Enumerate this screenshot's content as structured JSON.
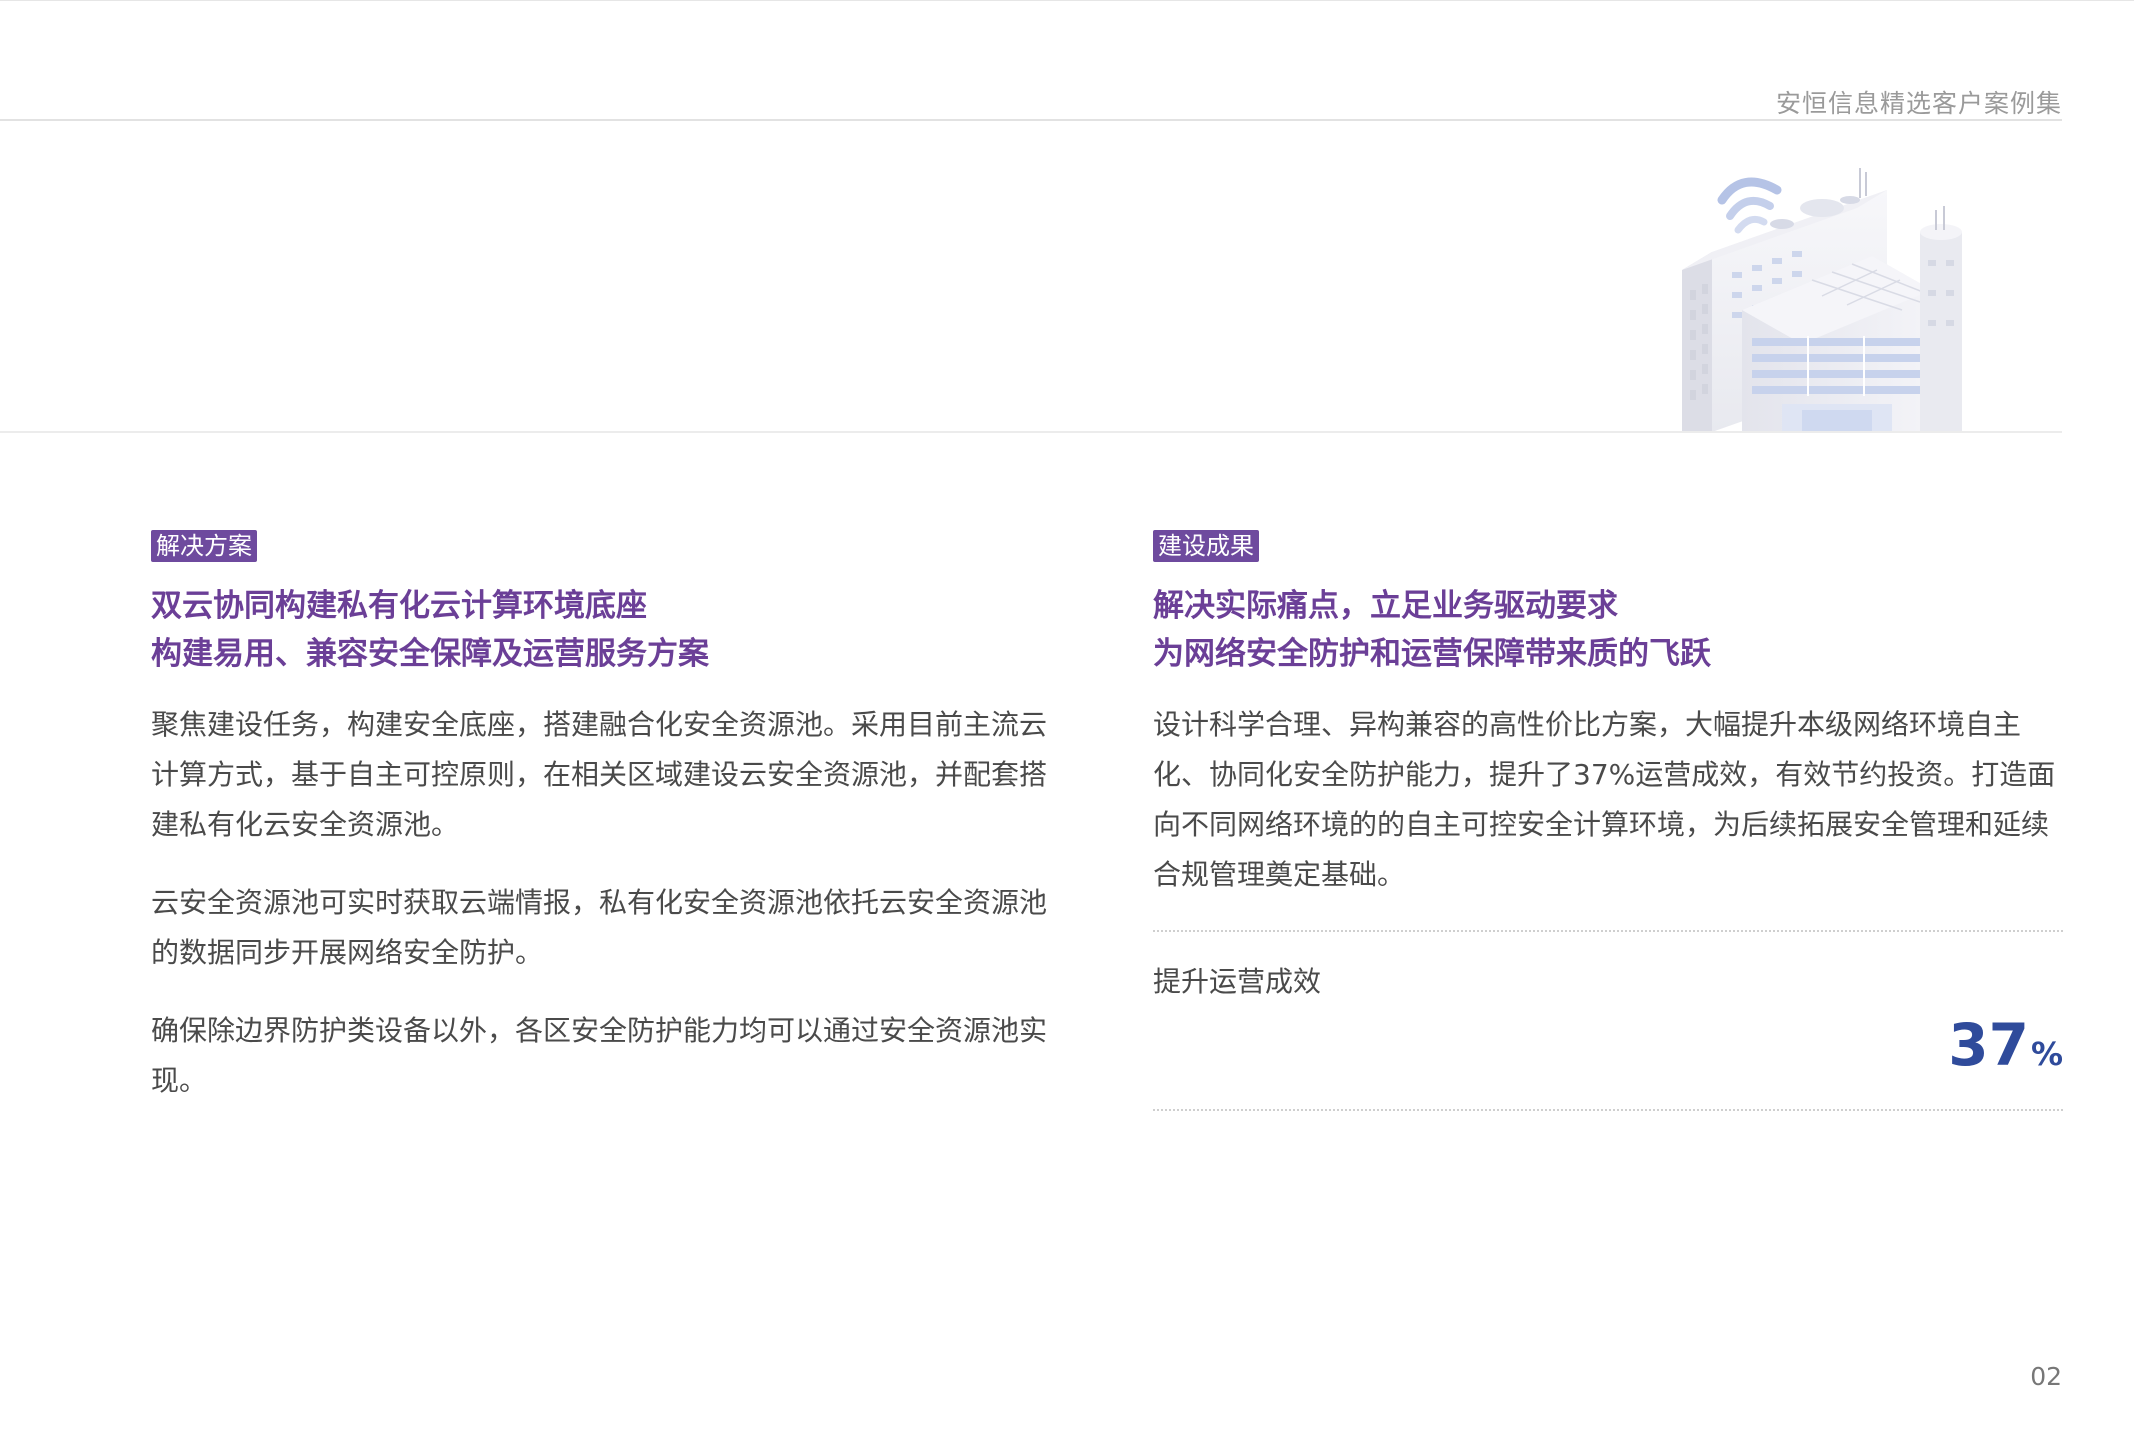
{
  "header": {
    "title": "安恒信息精选客户案例集"
  },
  "illustration": {
    "icon": "office-building-illustration-icon",
    "colors": {
      "building_light": "#f2f2f6",
      "building_shadow": "#dcdde6",
      "window": "#c9d3ea",
      "accent": "#a9b9df"
    }
  },
  "solution": {
    "tag": "解决方案",
    "headline_lines": [
      "双云协同构建私有化云计算环境底座",
      "构建易用、兼容安全保障及运营服务方案"
    ],
    "paragraphs": [
      "聚焦建设任务，构建安全底座，搭建融合化安全资源池。采用目前主流云计算方式，基于自主可控原则，在相关区域建设云安全资源池，并配套搭建私有化云安全资源池。",
      "云安全资源池可实时获取云端情报，私有化安全资源池依托云安全资源池的数据同步开展网络安全防护。",
      "确保除边界防护类设备以外，各区安全防护能力均可以通过安全资源池实现。"
    ]
  },
  "results": {
    "tag": "建设成果",
    "headline_lines": [
      "解决实际痛点，立足业务驱动要求",
      "为网络安全防护和运营保障带来质的飞跃"
    ],
    "paragraph": "设计科学合理、异构兼容的高性价比方案，大幅提升本级网络环境自主化、协同化安全防护能力，提升了37%运营成效，有效节约投资。打造面向不同网络环境的的自主可控安全计算环境，为后续拓展安全管理和延续合规管理奠定基础。",
    "metric": {
      "label": "提升运营成效",
      "value": "37",
      "unit": "%"
    }
  },
  "footer": {
    "page_number": "02"
  },
  "colors": {
    "accent_purple": "#6b3f97",
    "tag_purple": "#6e4a9e",
    "metric_blue": "#2f4b9b",
    "body_text": "#4a4a4a",
    "header_text": "#9a9a9a"
  }
}
